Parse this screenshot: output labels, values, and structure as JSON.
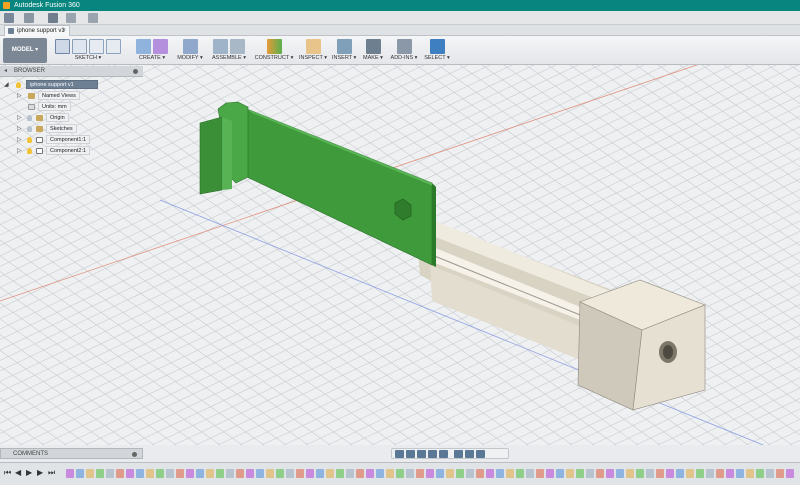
{
  "window": {
    "title": "Autodesk Fusion 360"
  },
  "document_tab": {
    "label": "iphone support v1"
  },
  "toolbar": {
    "workspace": "MODEL",
    "groups": [
      {
        "label": "SKETCH ▾"
      },
      {
        "label": "CREATE ▾"
      },
      {
        "label": "MODIFY ▾"
      },
      {
        "label": "ASSEMBLE ▾"
      },
      {
        "label": "CONSTRUCT ▾"
      },
      {
        "label": "INSPECT ▾"
      },
      {
        "label": "INSERT ▾"
      },
      {
        "label": "MAKE ▾"
      },
      {
        "label": "ADD-INS ▾"
      },
      {
        "label": "SELECT ▾"
      }
    ]
  },
  "browser": {
    "title": "BROWSER",
    "root": "iphone support v1",
    "items": [
      {
        "label": "Named Views"
      },
      {
        "label": "Units: mm"
      },
      {
        "label": "Origin"
      },
      {
        "label": "Sketches"
      },
      {
        "label": "Component1:1"
      },
      {
        "label": "Component2:1"
      }
    ]
  },
  "comments": {
    "title": "COMMENTS"
  },
  "colors": {
    "titlebar": "#08857e",
    "model_green": "#3f9a3c",
    "model_beige": "#e8e2d5",
    "grid_bg": "#eeeff1",
    "selected": "#3d7fc1"
  }
}
